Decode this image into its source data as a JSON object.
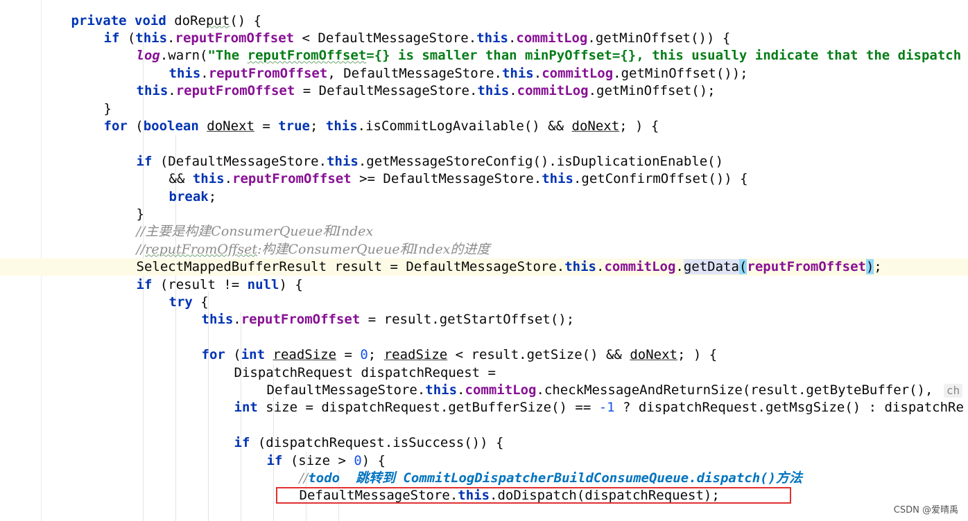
{
  "editor": {
    "language": "java",
    "current_line_index": 14,
    "lines": [
      {
        "indent": 2,
        "tokens": [
          [
            "kw",
            "private"
          ],
          [
            "",
            " "
          ],
          [
            "kw",
            "void"
          ],
          [
            "",
            " doRe"
          ],
          [
            "wavy",
            "put"
          ],
          [
            "",
            "() {"
          ]
        ]
      },
      {
        "indent": 3,
        "tokens": [
          [
            "kw",
            "if"
          ],
          [
            "",
            " ("
          ],
          [
            "kw",
            "this"
          ],
          [
            "",
            "."
          ],
          [
            "fld",
            "reputFromOffset"
          ],
          [
            "",
            " < DefaultMessageStore."
          ],
          [
            "kw",
            "this"
          ],
          [
            "",
            "."
          ],
          [
            "fld",
            "commitLog"
          ],
          [
            "",
            "."
          ],
          [
            "",
            "getMinOffset()) {"
          ]
        ]
      },
      {
        "indent": 4,
        "tokens": [
          [
            "stat",
            "log"
          ],
          [
            "",
            ".warn("
          ],
          [
            "str",
            "\"The "
          ],
          [
            "str wavy",
            "reputFromOffset"
          ],
          [
            "str",
            "={} is smaller than minPyOffset={}, this usually indicate that the dispatch"
          ]
        ]
      },
      {
        "indent": 5,
        "tokens": [
          [
            "kw",
            "this"
          ],
          [
            "",
            "."
          ],
          [
            "fld",
            "reputFromOffset"
          ],
          [
            "",
            ", DefaultMessageStore."
          ],
          [
            "kw",
            "this"
          ],
          [
            "",
            "."
          ],
          [
            "fld",
            "commitLog"
          ],
          [
            "",
            ".getMinOffset());"
          ]
        ]
      },
      {
        "indent": 4,
        "tokens": [
          [
            "kw",
            "this"
          ],
          [
            "",
            "."
          ],
          [
            "fld",
            "reputFromOffset"
          ],
          [
            "",
            " = DefaultMessageStore."
          ],
          [
            "kw",
            "this"
          ],
          [
            "",
            "."
          ],
          [
            "fld",
            "commitLog"
          ],
          [
            "",
            ".getMinOffset();"
          ]
        ]
      },
      {
        "indent": 3,
        "tokens": [
          [
            "",
            "}"
          ]
        ]
      },
      {
        "indent": 3,
        "tokens": [
          [
            "kw",
            "for"
          ],
          [
            "",
            " ("
          ],
          [
            "kw",
            "boolean"
          ],
          [
            "",
            " "
          ],
          [
            "ul",
            "doNext"
          ],
          [
            "",
            " = "
          ],
          [
            "kw",
            "true"
          ],
          [
            "",
            "; "
          ],
          [
            "kw",
            "this"
          ],
          [
            "",
            ".isCommitLogAvailable() && "
          ],
          [
            "ul",
            "doNext"
          ],
          [
            "",
            "; ) {"
          ]
        ]
      },
      {
        "indent": 0,
        "tokens": []
      },
      {
        "indent": 4,
        "tokens": [
          [
            "kw",
            "if"
          ],
          [
            "",
            " (DefaultMessageStore."
          ],
          [
            "kw",
            "this"
          ],
          [
            "",
            ".getMessageStoreConfig().isDuplicationEnable()"
          ]
        ]
      },
      {
        "indent": 5,
        "tokens": [
          [
            "",
            "&& "
          ],
          [
            "kw",
            "this"
          ],
          [
            "",
            "."
          ],
          [
            "fld",
            "reputFromOffset"
          ],
          [
            "",
            " >= DefaultMessageStore."
          ],
          [
            "kw",
            "this"
          ],
          [
            "",
            ".getConfirmOffset()) {"
          ]
        ]
      },
      {
        "indent": 5,
        "tokens": [
          [
            "kw",
            "break"
          ],
          [
            "",
            ";"
          ]
        ]
      },
      {
        "indent": 4,
        "tokens": [
          [
            "",
            "}"
          ]
        ]
      },
      {
        "indent": 4,
        "tokens": [
          [
            "cmt",
            "//主要是构建ConsumerQueue和Index"
          ]
        ]
      },
      {
        "indent": 4,
        "tokens": [
          [
            "cmt",
            "//"
          ],
          [
            "cmt wavy",
            "reputFromOffset"
          ],
          [
            "cmt",
            ":构建ConsumerQueue和Index的进度"
          ]
        ]
      },
      {
        "indent": 4,
        "tokens": [
          [
            "",
            "SelectMappedBufferResult result = DefaultMessageStore."
          ],
          [
            "kw",
            "this"
          ],
          [
            "",
            "."
          ],
          [
            "fld",
            "commitLog"
          ],
          [
            "",
            "."
          ],
          [
            "hl-method",
            "getData"
          ],
          [
            "hl-bracket",
            "("
          ],
          [
            "fld",
            "reputFromOffset"
          ],
          [
            "hl-bracket",
            ")"
          ],
          [
            "",
            ";"
          ]
        ]
      },
      {
        "indent": 4,
        "tokens": [
          [
            "kw",
            "if"
          ],
          [
            "",
            " (result != "
          ],
          [
            "kw",
            "null"
          ],
          [
            "",
            ") {"
          ]
        ]
      },
      {
        "indent": 5,
        "tokens": [
          [
            "kw",
            "try"
          ],
          [
            "",
            " {"
          ]
        ]
      },
      {
        "indent": 6,
        "tokens": [
          [
            "kw",
            "this"
          ],
          [
            "",
            "."
          ],
          [
            "fld",
            "reputFromOffset"
          ],
          [
            "",
            " = result.getStartOffset();"
          ]
        ]
      },
      {
        "indent": 0,
        "tokens": []
      },
      {
        "indent": 6,
        "tokens": [
          [
            "kw",
            "for"
          ],
          [
            "",
            " ("
          ],
          [
            "kw",
            "int"
          ],
          [
            "",
            " "
          ],
          [
            "ul",
            "readSize"
          ],
          [
            "",
            " = "
          ],
          [
            "num",
            "0"
          ],
          [
            "",
            "; "
          ],
          [
            "ul",
            "readSize"
          ],
          [
            "",
            " < result.getSize() && "
          ],
          [
            "ul",
            "doNext"
          ],
          [
            "",
            "; ) {"
          ]
        ]
      },
      {
        "indent": 7,
        "tokens": [
          [
            "",
            "DispatchRequest dispatchRequest ="
          ]
        ]
      },
      {
        "indent": 8,
        "tokens": [
          [
            "",
            "DefaultMessageStore."
          ],
          [
            "kw",
            "this"
          ],
          [
            "",
            "."
          ],
          [
            "fld",
            "commitLog"
          ],
          [
            "",
            ".checkMessageAndReturnSize(result.getByteBuffer(), "
          ],
          [
            "hint",
            "ch"
          ]
        ]
      },
      {
        "indent": 7,
        "tokens": [
          [
            "kw",
            "int"
          ],
          [
            "",
            " size = dispatchRequest.getBufferSize() == "
          ],
          [
            "num",
            "-1"
          ],
          [
            "",
            " ? dispatchRequest.getMsgSize() : dispatchRe"
          ]
        ]
      },
      {
        "indent": 0,
        "tokens": []
      },
      {
        "indent": 7,
        "tokens": [
          [
            "kw",
            "if"
          ],
          [
            "",
            " (dispatchRequest.isSuccess()) {"
          ]
        ]
      },
      {
        "indent": 8,
        "tokens": [
          [
            "kw",
            "if"
          ],
          [
            "",
            " (size > "
          ],
          [
            "num",
            "0"
          ],
          [
            "",
            ") {"
          ]
        ]
      },
      {
        "indent": 9,
        "tokens": [
          [
            "cmt",
            "//"
          ],
          [
            "todo",
            "todo  跳转到 CommitLogDispatcherBuildConsumeQueue.dispatch()方法"
          ]
        ]
      },
      {
        "indent": 9,
        "tokens": [
          [
            "",
            "DefaultMessageStore."
          ],
          [
            "kw",
            "this"
          ],
          [
            "",
            ".doDispatch(dispatchRequest);"
          ]
        ]
      }
    ]
  },
  "annotation": {
    "highlighted_line_index": 27,
    "border_color": "#e03030"
  },
  "watermark": "CSDN @爱晴禹"
}
